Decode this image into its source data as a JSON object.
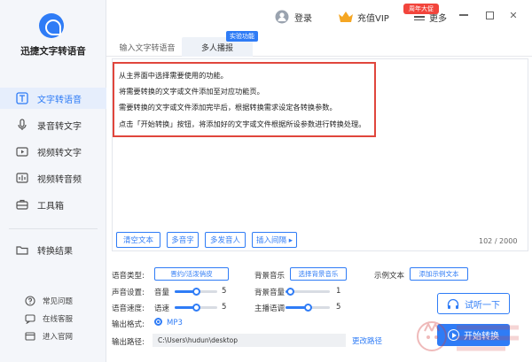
{
  "app": {
    "title": "迅捷文字转语音"
  },
  "sidebar": {
    "items": [
      {
        "label": "文字转语音",
        "icon": "text-icon",
        "active": true
      },
      {
        "label": "录音转文字",
        "icon": "microphone-icon"
      },
      {
        "label": "视频转文字",
        "icon": "video-icon"
      },
      {
        "label": "视频转音频",
        "icon": "video-audio-icon"
      },
      {
        "label": "工具箱",
        "icon": "toolbox-icon"
      },
      {
        "label": "转换结果",
        "icon": "result-folder-icon"
      }
    ],
    "links": [
      {
        "label": "常见问题",
        "icon": "question-icon"
      },
      {
        "label": "在线客服",
        "icon": "service-icon"
      },
      {
        "label": "进入官网",
        "icon": "website-icon"
      }
    ]
  },
  "topbar": {
    "login": "登录",
    "vip": "充值VIP",
    "vip_badge": "周年大促",
    "more": "更多",
    "window_controls": [
      "minimize-icon",
      "maximize-icon",
      "close-icon"
    ]
  },
  "tabs": {
    "items": [
      {
        "label": "输入文字转语音"
      },
      {
        "label": "多人播报"
      }
    ],
    "active": 1,
    "badge": "实验功能"
  },
  "editor": {
    "lines": [
      "从主界面中选择需要使用的功能。",
      "将需要转换的文字或文件添加至对应功能页。",
      "需要转换的文字或文件添加完毕后，根据转换需求设定各转换参数。",
      "点击「开始转换」按钮，将添加好的文字或文件根据所设参数进行转换处理。"
    ],
    "buttons": [
      "清空文本",
      "多音字",
      "多发音人",
      "插入间隔 ▸"
    ],
    "counter": "102 / 2000"
  },
  "settings": {
    "voice_type_label": "语音类型:",
    "voice_type_value": "晋约/活泼俏皮",
    "bg_music_label": "背景音乐",
    "bg_music_button": "选择背景音乐",
    "example_label": "示例文本",
    "example_button": "添加示例文本",
    "sound_label": "声音设置:",
    "volume_label": "音量",
    "volume_value": "5",
    "volume_level": 0.5,
    "bg_volume_label": "背景音量",
    "bg_volume_value": "1",
    "bg_volume_level": 0.1,
    "speed_label": "语音速度:",
    "speed_sublabel": "语速",
    "speed_value": "5",
    "speed_level": 0.5,
    "tone_label": "主播语调",
    "tone_value": "5",
    "tone_level": 0.5,
    "format_label": "输出格式:",
    "format_value": "MP3",
    "path_label": "输出路径:",
    "path_value": "C:\\Users\\hudun\\desktop",
    "change_path": "更改路径"
  },
  "actions": {
    "listen": "试听一下",
    "start": "开始转换"
  },
  "colors": {
    "accent": "#2f7cf6",
    "highlight_border": "#e0463c",
    "badge_red": "#f2453c"
  }
}
